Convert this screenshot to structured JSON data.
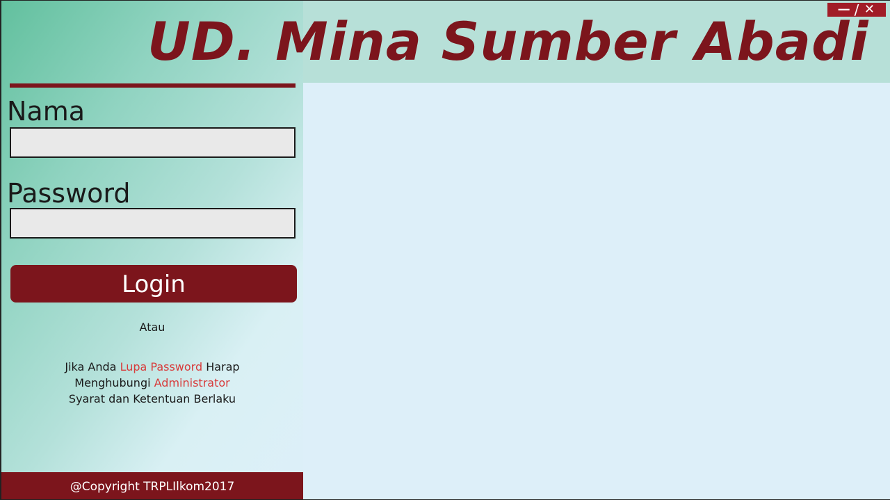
{
  "header": {
    "title": "UD. Mina Sumber Abadi",
    "minimize_glyph": "—",
    "separator_glyph": "/",
    "close_glyph": "✕"
  },
  "login_form": {
    "name_label": "Nama",
    "name_value": "",
    "name_placeholder": "",
    "password_label": "Password",
    "password_value": "",
    "password_placeholder": "",
    "login_label": "Login",
    "or_text": "Atau"
  },
  "info": {
    "line1_prefix": "Jika Anda ",
    "line1_link": "Lupa Password",
    "line1_suffix": " Harap",
    "line2_prefix": "Menghubungi ",
    "line2_link": "Administrator",
    "line3": "Syarat dan Ketentuan Berlaku"
  },
  "footer": {
    "copyright": "@Copyright TRPLIlkom2017"
  },
  "colors": {
    "brand": "#7c151c",
    "link": "#d83a3a",
    "window_controls": "#a11c27",
    "header_bg": "#b7e0d8",
    "content_bg": "#ddeff9",
    "panel_gradient_start": "#62c09e"
  }
}
